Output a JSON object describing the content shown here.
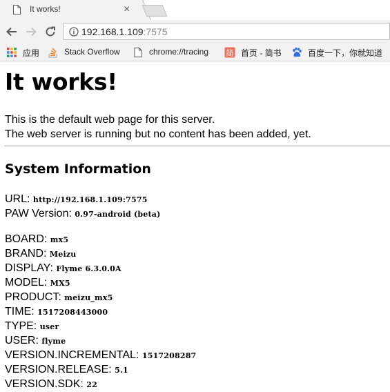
{
  "browser": {
    "tab_title": "It works!",
    "tab_close": "×",
    "address": {
      "host": "192.168.1.109",
      "port": ":7575"
    },
    "bookmarks": [
      {
        "label": "应用",
        "icon": "apps-grid-icon"
      },
      {
        "label": "Stack Overflow",
        "icon": "stackoverflow-icon"
      },
      {
        "label": "chrome://tracing",
        "icon": "page-icon"
      },
      {
        "label": "首页 - 简书",
        "icon": "jianshu-icon"
      },
      {
        "label": "百度一下，你就知道",
        "icon": "baidu-paw-icon"
      }
    ],
    "colors": {
      "jianshu": "#ea6f5a",
      "baidu": "#2f6ee0"
    }
  },
  "page": {
    "heading": "It works!",
    "intro_line1": "This is the default web page for this server.",
    "intro_line2": "The web server is running but no content has been added, yet.",
    "section_title": "System Information",
    "server_info": [
      {
        "key": "URL:",
        "value": "http://192.168.1.109:7575"
      },
      {
        "key": "PAW Version:",
        "value": "0.97-android (beta)"
      }
    ],
    "device_info": [
      {
        "key": "BOARD:",
        "value": "mx5"
      },
      {
        "key": "BRAND:",
        "value": "Meizu"
      },
      {
        "key": "DISPLAY:",
        "value": "Flyme 6.3.0.0A"
      },
      {
        "key": "MODEL:",
        "value": "MX5"
      },
      {
        "key": "PRODUCT:",
        "value": "meizu_mx5"
      },
      {
        "key": "TIME:",
        "value": "1517208443000"
      },
      {
        "key": "TYPE:",
        "value": "user"
      },
      {
        "key": "USER:",
        "value": "flyme"
      },
      {
        "key": "VERSION.INCREMENTAL:",
        "value": "1517208287"
      },
      {
        "key": "VERSION.RELEASE:",
        "value": "5.1"
      },
      {
        "key": "VERSION.SDK:",
        "value": "22"
      }
    ]
  }
}
